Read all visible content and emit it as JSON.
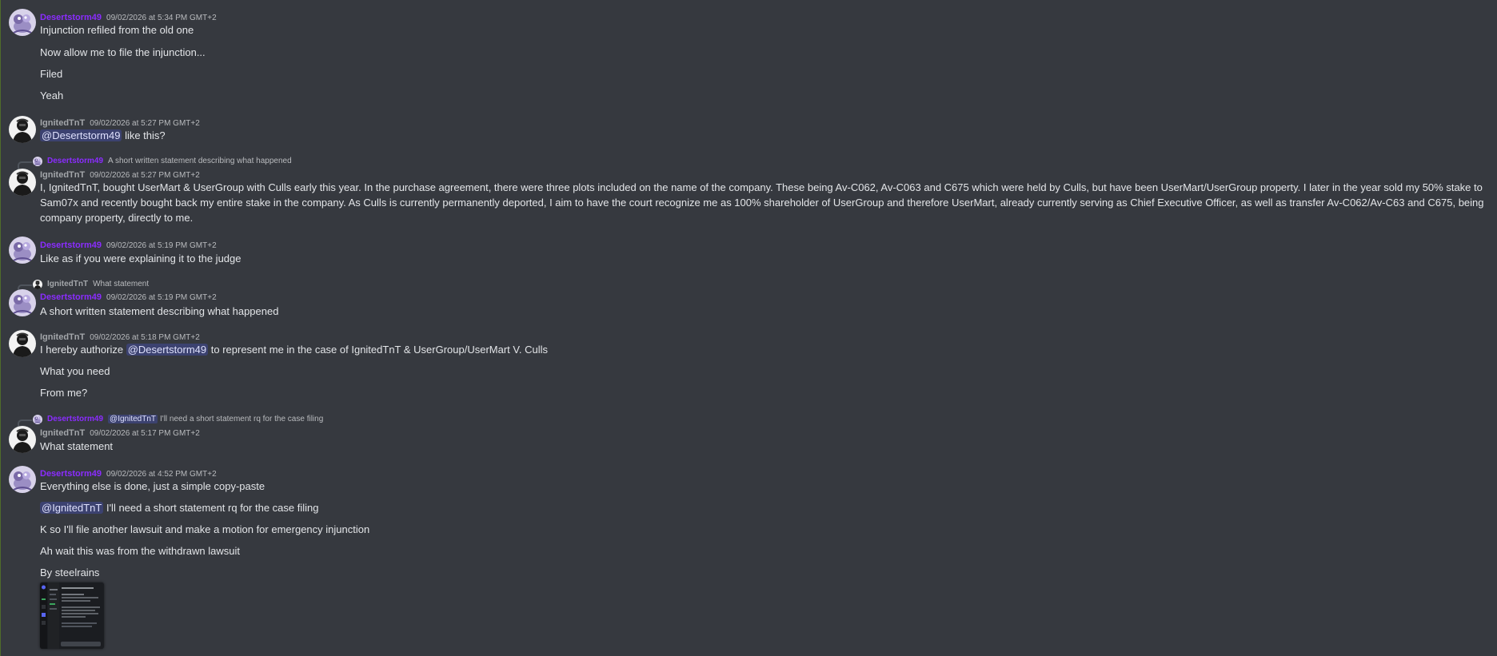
{
  "users": {
    "desert": "Desertstorm49",
    "ignited": "IgnitedTnT"
  },
  "colors": {
    "background": "#36393f",
    "desert_name": "#8b2cff",
    "ignited_name": "#a3a6aa",
    "mention_bg": "#3c4270"
  },
  "messages": [
    {
      "author": "Desertstorm49",
      "timestamp": "09/02/2026 at 5:34 PM GMT+2",
      "lines": [
        "Injunction refiled from the old one",
        "Now allow me to file the injunction...",
        "Filed",
        "Yeah"
      ]
    },
    {
      "author": "IgnitedTnT",
      "timestamp": "09/02/2026 at 5:27 PM GMT+2",
      "mention": "@Desertstorm49",
      "text_after": " like this?"
    },
    {
      "reply_to": {
        "author": "Desertstorm49",
        "text": "A short written statement describing what happened"
      },
      "author": "IgnitedTnT",
      "timestamp": "09/02/2026 at 5:27 PM GMT+2",
      "text": "I, IgnitedTnT, bought UserMart & UserGroup with Culls early this year. In the purchase agreement, there were three plots included on the name of the company. These being Av-C062, Av-C063 and C675 which were held by Culls, but have been UserMart/UserGroup property. I later in the year sold my 50% stake to Sam07x and recently bought back my entire stake in the company. As Culls is currently permanently deported, I aim to have the court recognize me as 100% shareholder of UserGroup and therefore UserMart, already currently serving as Chief Executive Officer, as well as transfer Av-C062/Av-C63 and C675, being company property, directly to me."
    },
    {
      "author": "Desertstorm49",
      "timestamp": "09/02/2026 at 5:19 PM GMT+2",
      "text": "Like as if you were explaining it to the judge"
    },
    {
      "reply_to": {
        "author": "IgnitedTnT",
        "text": "What statement"
      },
      "author": "Desertstorm49",
      "timestamp": "09/02/2026 at 5:19 PM GMT+2",
      "text": "A short written statement describing what happened"
    },
    {
      "author": "IgnitedTnT",
      "timestamp": "09/02/2026 at 5:18 PM GMT+2",
      "first_before": "I hereby authorize ",
      "mention": "@Desertstorm49",
      "first_after": " to represent me in the case of IgnitedTnT & UserGroup/UserMart V. Culls",
      "lines": [
        "What you need",
        "From me?"
      ]
    },
    {
      "reply_to": {
        "author": "Desertstorm49",
        "mention": "@IgnitedTnT",
        "text": "I'll need a short statement rq for the case filing"
      },
      "author": "IgnitedTnT",
      "timestamp": "09/02/2026 at 5:17 PM GMT+2",
      "text": "What statement"
    },
    {
      "author": "Desertstorm49",
      "timestamp": "09/02/2026 at 4:52 PM GMT+2",
      "line1": "Everything else is done, just a simple copy-paste",
      "mention": "@IgnitedTnT",
      "line2_after": " I'll need a short statement rq for the case filing",
      "lines": [
        "K so I'll file another lawsuit and make a motion for emergency injunction",
        "Ah wait this was from the withdrawn lawsuit",
        "By steelrains"
      ],
      "attachment": "image-attachment"
    }
  ]
}
